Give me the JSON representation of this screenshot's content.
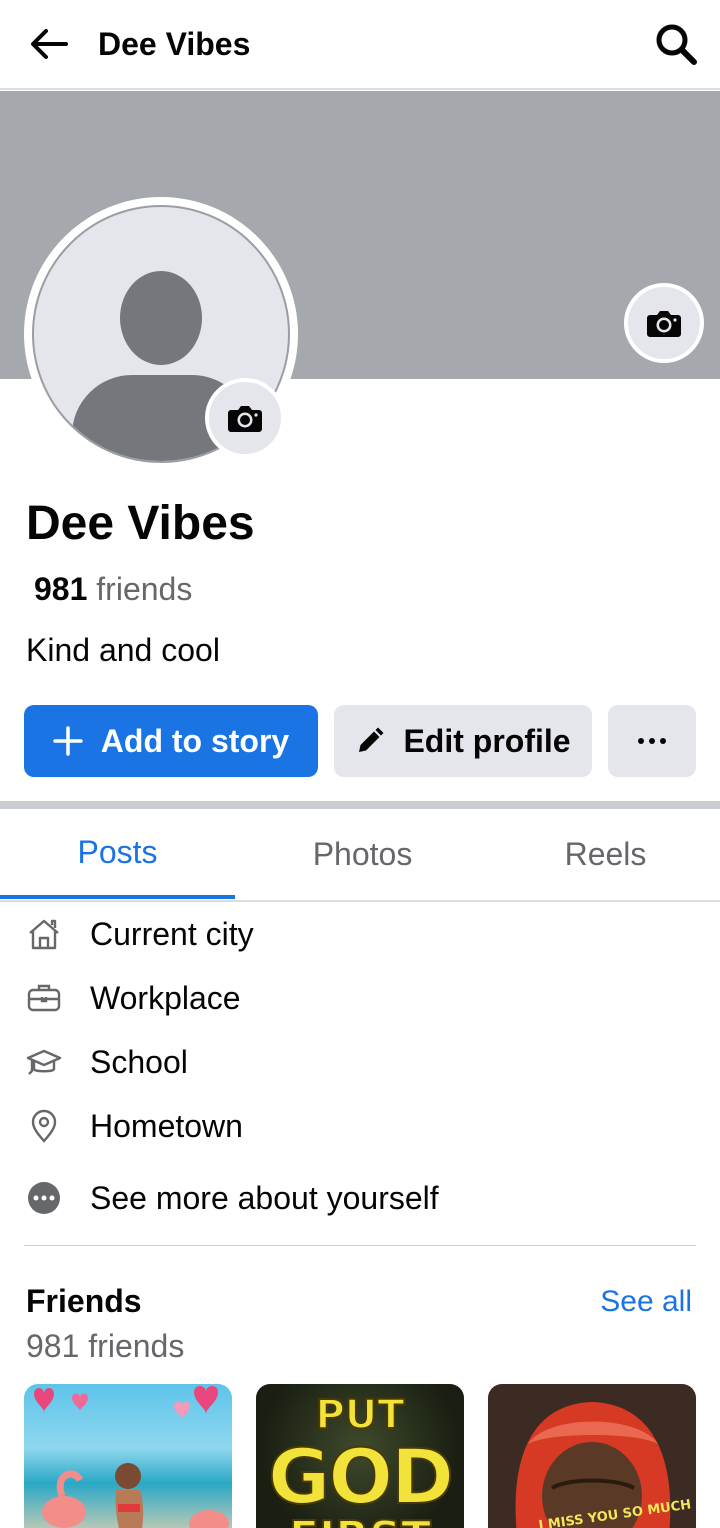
{
  "header": {
    "title": "Dee Vibes",
    "back_icon": "arrow-left-icon",
    "search_icon": "search-icon"
  },
  "profile": {
    "name": "Dee Vibes",
    "friends_count": "981",
    "friends_word": "friends",
    "bio": "Kind and cool"
  },
  "actions": {
    "add_story": "Add to story",
    "edit_profile": "Edit profile",
    "more": "···"
  },
  "tabs": [
    {
      "label": "Posts",
      "active": true
    },
    {
      "label": "Photos",
      "active": false
    },
    {
      "label": "Reels",
      "active": false
    }
  ],
  "about": [
    {
      "label": "Current city",
      "icon": "home-icon"
    },
    {
      "label": "Workplace",
      "icon": "briefcase-icon"
    },
    {
      "label": "School",
      "icon": "graduation-cap-icon"
    },
    {
      "label": "Hometown",
      "icon": "location-pin-icon"
    },
    {
      "label": "See more about yourself",
      "icon": "more-dots-icon"
    }
  ],
  "friends_section": {
    "title": "Friends",
    "see_all": "See all",
    "count_text": "981 friends",
    "tiles": [
      {
        "text": ""
      },
      {
        "text_line1": "PUT",
        "text_line2": "GOD",
        "text_line3": "FIRST"
      },
      {
        "text": "I MISS YOU SO MUCH"
      }
    ]
  },
  "colors": {
    "accent": "#1b74e4",
    "cover": "#a5a8ad",
    "button_gray": "#e4e6eb"
  }
}
